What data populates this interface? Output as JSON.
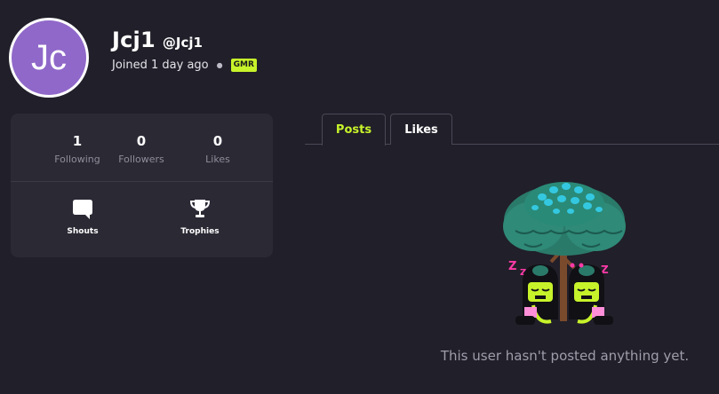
{
  "profile": {
    "avatar_initials": "Jc",
    "display_name": "Jcj1",
    "handle": "@Jcj1",
    "joined": "Joined 1 day ago",
    "badge": "GMR"
  },
  "stats": [
    {
      "value": "1",
      "label": "Following"
    },
    {
      "value": "0",
      "label": "Followers"
    },
    {
      "value": "0",
      "label": "Likes"
    }
  ],
  "actions": [
    {
      "label": "Shouts",
      "icon": "chat-bubble-icon"
    },
    {
      "label": "Trophies",
      "icon": "trophy-icon"
    }
  ],
  "tabs": [
    {
      "label": "Posts",
      "active": true
    },
    {
      "label": "Likes",
      "active": false
    }
  ],
  "empty_message": "This user hasn't posted anything yet.",
  "colors": {
    "background": "#211f29",
    "card": "#2b2934",
    "accent": "#c7f32a",
    "avatar": "#9068c9"
  }
}
